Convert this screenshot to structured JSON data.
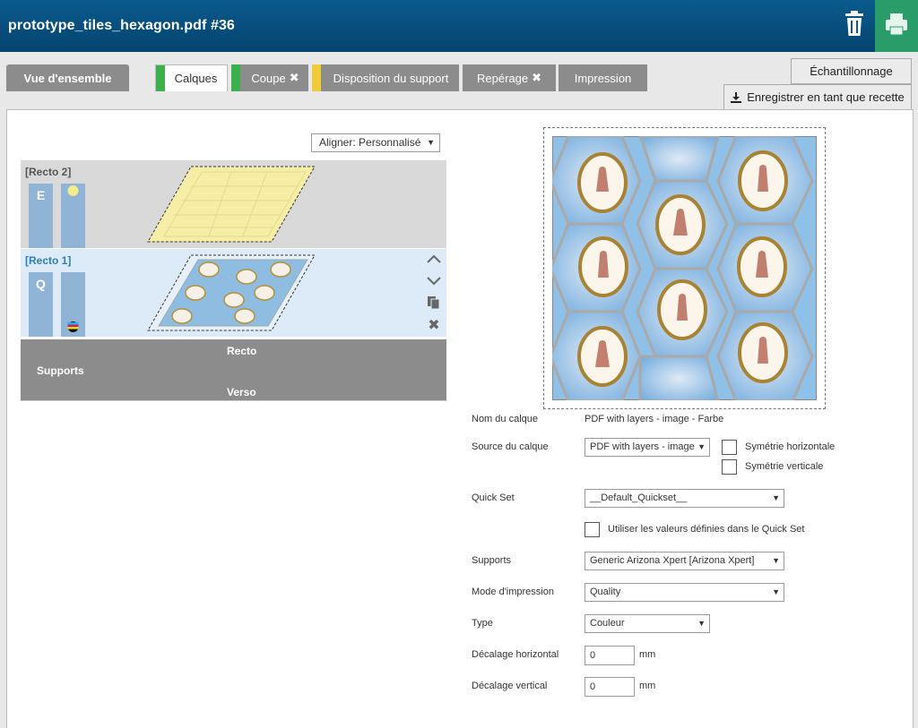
{
  "header": {
    "title": "prototype_tiles_hexagon.pdf #36"
  },
  "tabs": {
    "overview": "Vue d'ensemble",
    "layers": "Calques",
    "cut": "Coupe",
    "layout": "Disposition du support",
    "registration": "Repérage",
    "print": "Impression"
  },
  "tab_markers": {
    "layers": "#3cb04a",
    "cut": "#3cb04a",
    "layout": "#f1cc3a"
  },
  "actions": {
    "sampling": "Échantillonnage",
    "save_recipe": "Enregistrer en tant que recette"
  },
  "align": {
    "value": "Aligner: Personnalisé"
  },
  "layers": [
    {
      "name": "[Recto 2]",
      "letter": "E"
    },
    {
      "name": "[Recto 1]",
      "letter": "Q"
    }
  ],
  "supports": {
    "label": "Supports",
    "recto": "Recto",
    "verso": "Verso"
  },
  "form": {
    "layer_name_label": "Nom du calque",
    "layer_name_value": "PDF with layers - image - Farbe",
    "source_label": "Source du calque",
    "source_value": "PDF with layers - image",
    "mirror_h": "Symétrie horizontale",
    "mirror_v": "Symétrie verticale",
    "quickset_label": "Quick Set",
    "quickset_value": "__Default_Quickset__",
    "use_quickset": "Utiliser les valeurs définies dans le Quick Set",
    "media_label": "Supports",
    "media_value": "Generic Arizona Xpert [Arizona Xpert]",
    "mode_label": "Mode d'impression",
    "mode_value": "Quality",
    "type_label": "Type",
    "type_value": "Couleur",
    "offset_h_label": "Décalage horizontal",
    "offset_h_value": "0",
    "offset_v_label": "Décalage vertical",
    "offset_v_value": "0",
    "unit": "mm"
  }
}
